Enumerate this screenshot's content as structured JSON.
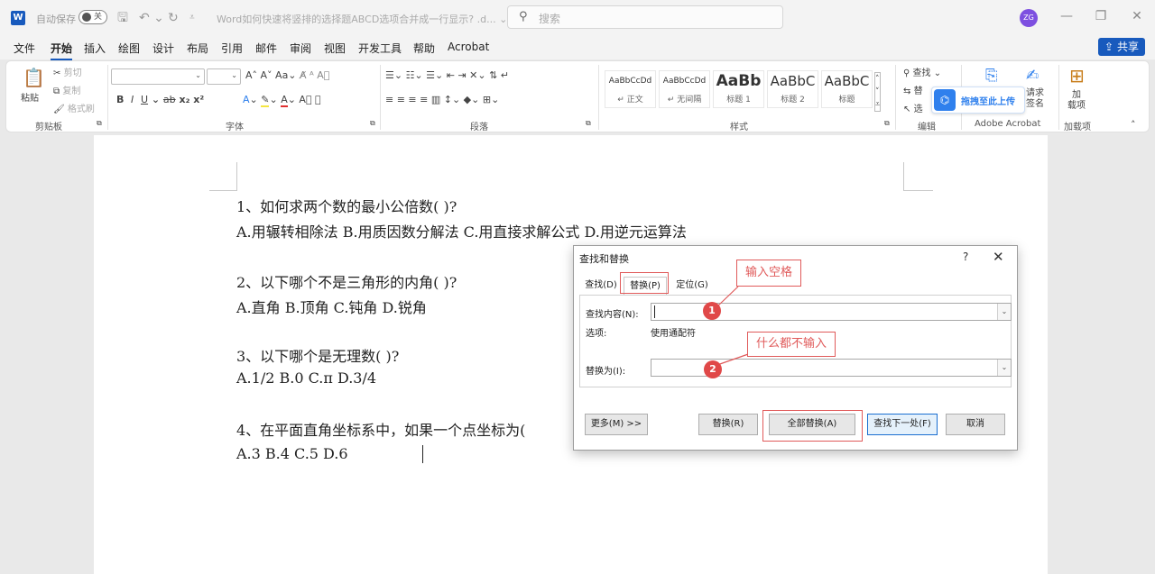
{
  "titlebar": {
    "app_icon": "W",
    "autosave_label": "自动保存",
    "autosave_state": "关",
    "doc_title": "Word如何快速将竖排的选择题ABCD选项合并成一行显示? .d...  ⌄",
    "search_placeholder": "搜索",
    "avatar": "ZG"
  },
  "menu": {
    "tabs": [
      "文件",
      "开始",
      "插入",
      "绘图",
      "设计",
      "布局",
      "引用",
      "邮件",
      "审阅",
      "视图",
      "开发工具",
      "帮助",
      "Acrobat"
    ],
    "active": "开始",
    "share": "共享"
  },
  "ribbon": {
    "clipboard": {
      "paste": "粘贴",
      "cut": "剪切",
      "copy": "复制",
      "format_painter": "格式刷",
      "label": "剪贴板"
    },
    "font": {
      "label": "字体"
    },
    "paragraph": {
      "label": "段落"
    },
    "styles": {
      "label": "样式",
      "items": [
        {
          "preview": "AaBbCcDd",
          "name": "↵ 正文"
        },
        {
          "preview": "AaBbCcDd",
          "name": "↵ 无间隔"
        },
        {
          "preview": "AaBb",
          "name": "标题 1"
        },
        {
          "preview": "AaBbC",
          "name": "标题 2"
        },
        {
          "preview": "AaBbC",
          "name": "标题"
        }
      ]
    },
    "editing": {
      "find": "查找",
      "replace": "替",
      "select": "选",
      "label": "编辑"
    },
    "acrobat": {
      "upload": "拖拽至此上传",
      "request_sign_1": "请求",
      "request_sign_2": "签名",
      "label": "Adobe Acrobat"
    },
    "addins": {
      "label_1": "加",
      "label_2": "载项",
      "label": "加载项"
    }
  },
  "document": {
    "lines": [
      "1、如何求两个数的最小公倍数( )?",
      "A.用辗转相除法  B.用质因数分解法  C.用直接求解公式 D.用逆元运算法",
      "2、以下哪个不是三角形的内角( )?",
      "A.直角 B.顶角  C.钝角 D.锐角",
      "3、以下哪个是无理数( )?",
      "A.1/2  B.0   C.π    D.3/4",
      "4、在平面直角坐标系中，如果一个点坐标为(",
      "A.3   B.4    C.5   D.6"
    ]
  },
  "dialog": {
    "title": "查找和替换",
    "help": "?",
    "close": "✕",
    "tabs": [
      "查找(D)",
      "替换(P)",
      "定位(G)"
    ],
    "active_tab": "替换(P)",
    "find_label": "查找内容(N):",
    "find_value": "",
    "options_label": "选项:",
    "options_value": "使用通配符",
    "replace_label": "替换为(I):",
    "replace_value": "",
    "buttons": {
      "more": "更多(M) >>",
      "replace": "替换(R)",
      "replace_all": "全部替换(A)",
      "find_next": "查找下一处(F)",
      "cancel": "取消"
    }
  },
  "annotations": {
    "note1": "输入空格",
    "note2": "什么都不输入",
    "step1": "1",
    "step2": "2",
    "color": "#e05a5a"
  }
}
